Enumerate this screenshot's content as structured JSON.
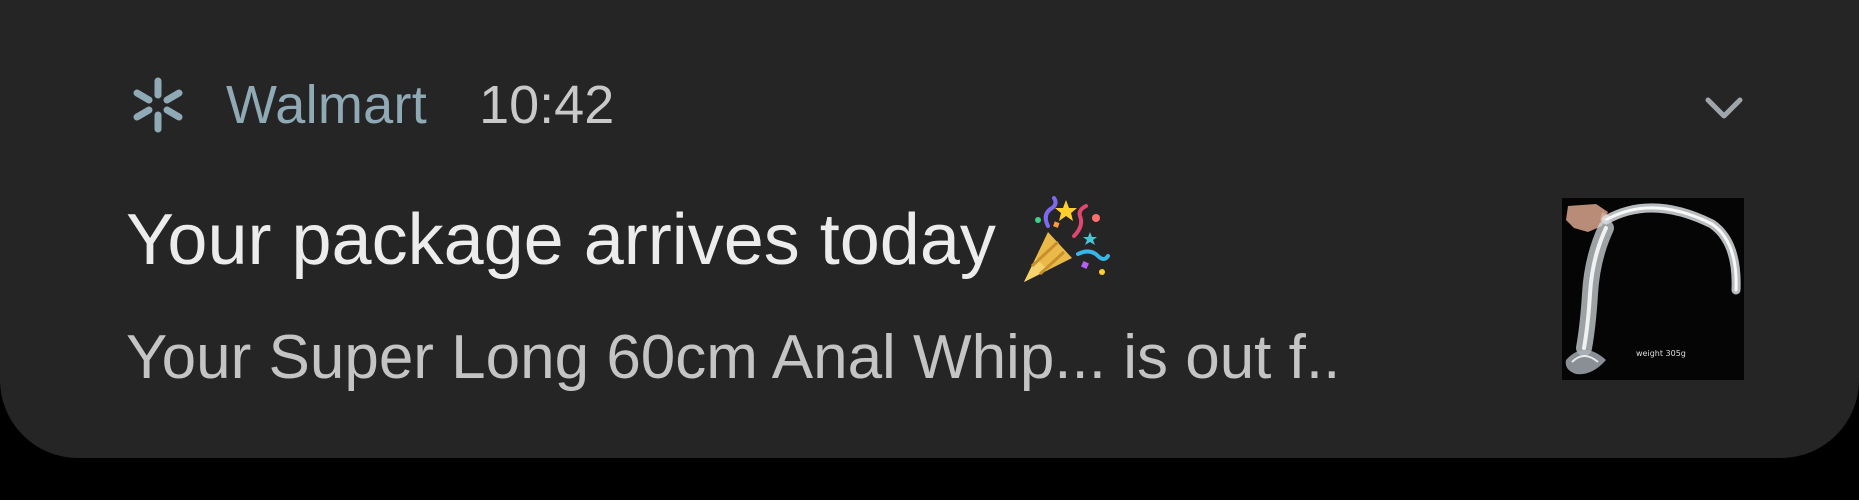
{
  "notification": {
    "app_icon": "walmart-spark-icon",
    "app_name": "Walmart",
    "time": "10:42",
    "title": "Your package arrives today",
    "title_emoji": "party-popper-icon",
    "body": "Your Super Long 60cm Anal Whip... is out f..",
    "expand_icon": "chevron-down-icon",
    "thumbnail": "product-thumbnail",
    "thumbnail_caption": "weight 305g"
  },
  "colors": {
    "background": "#000000",
    "card": "#252525",
    "app_name": "#8fa9b5",
    "title": "#ececec",
    "body": "#c4c4c4"
  }
}
